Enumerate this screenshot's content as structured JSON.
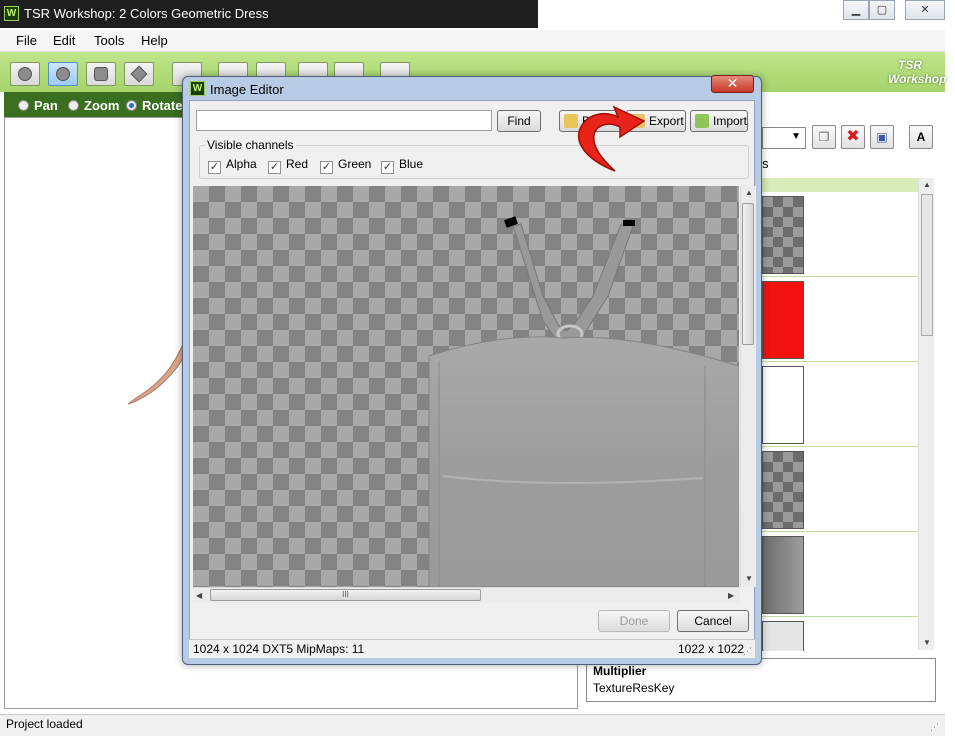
{
  "window": {
    "title": "TSR Workshop: 2 Colors Geometric Dress",
    "icon": "W",
    "controls": [
      "minimize-icon",
      "maximize-icon",
      "close-icon"
    ]
  },
  "menu": [
    "File",
    "Edit",
    "Tools",
    "Help"
  ],
  "logo": {
    "line1": "TSR",
    "line2": "Workshop"
  },
  "view_modes": [
    {
      "label": "Pan",
      "selected": false
    },
    {
      "label": "Zoom",
      "selected": false
    },
    {
      "label": "Rotate",
      "selected": true
    }
  ],
  "right_panel": {
    "tab_fragment": "s",
    "thumbnails": [
      "transparent-checker",
      "red",
      "white",
      "gray-checker",
      "dark-gray",
      "light-gray"
    ],
    "property": {
      "name": "Multiplier",
      "value": "TextureResKey"
    }
  },
  "status": "Project loaded",
  "dialog": {
    "icon": "W",
    "title": "Image Editor",
    "search": {
      "value": "",
      "placeholder": ""
    },
    "find_label": "Find",
    "browse_label": "B",
    "export_label": "Export",
    "import_label": "Import",
    "channels_label": "Visible channels",
    "channels": [
      {
        "label": "Alpha",
        "checked": true
      },
      {
        "label": "Red",
        "checked": true
      },
      {
        "label": "Green",
        "checked": true
      },
      {
        "label": "Blue",
        "checked": true
      }
    ],
    "done_label": "Done",
    "cancel_label": "Cancel",
    "info": "1024 x 1024 DXT5 MipMaps: 11",
    "dims": "1022 x 1022",
    "scroll_grip": "III"
  },
  "colors": {
    "toolbar_green": "#a6d36c",
    "radio_bar_green": "#3a6e20",
    "annotation_arrow_red": "#e8231a",
    "dialog_frame": "#b7cce4"
  }
}
